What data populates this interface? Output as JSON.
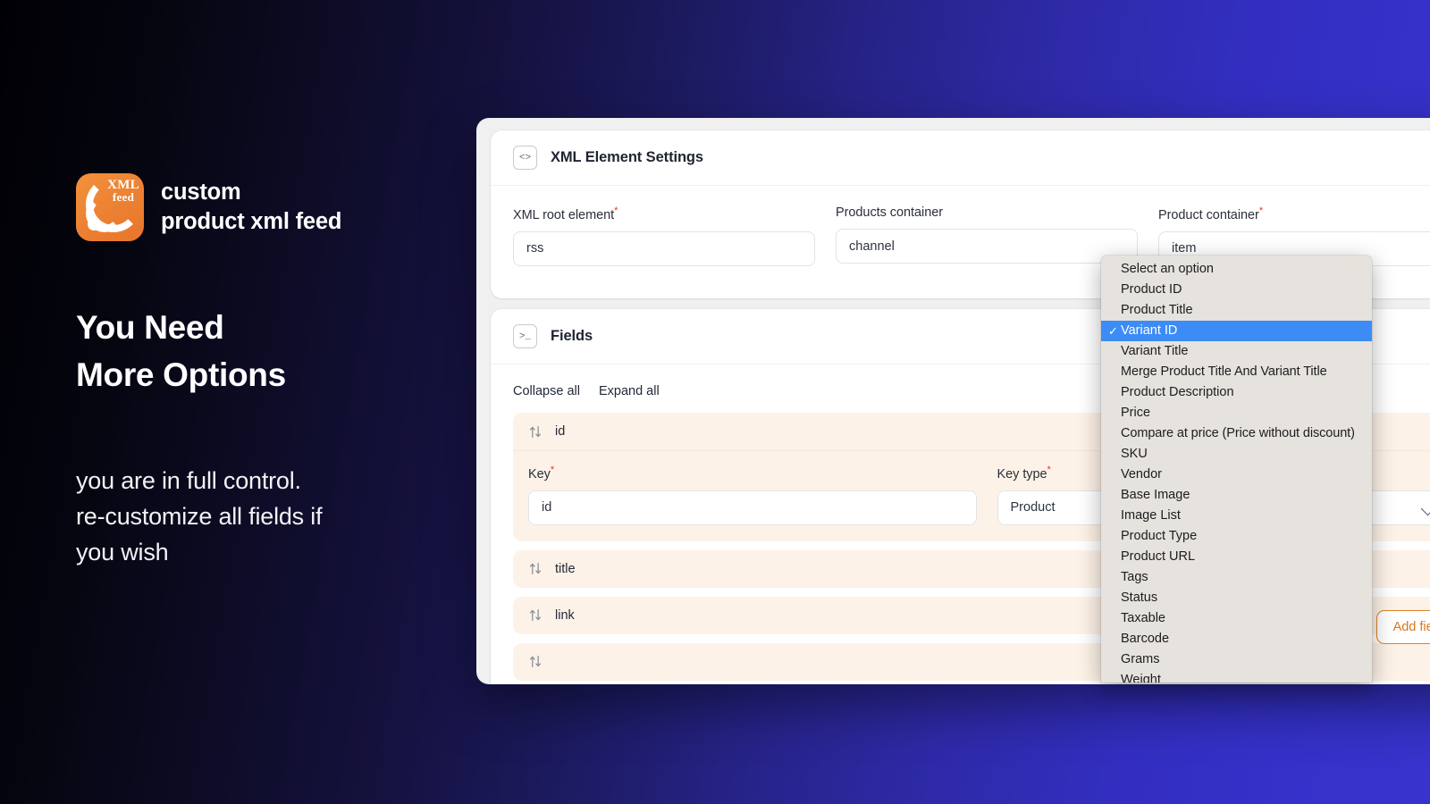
{
  "promo": {
    "logo_icon": "rss-xml-feed-icon",
    "logo_badge_top": "XML",
    "logo_badge_bottom": "feed",
    "brand_line1": "custom",
    "brand_line2": "product xml feed",
    "headline_line1": "You Need",
    "headline_line2": "More Options",
    "subcopy_line1": "you are in full control.",
    "subcopy_line2": "re-customize all fields if",
    "subcopy_line3": "you wish"
  },
  "colors": {
    "brand_orange": "#e8752b",
    "accent_blue": "#3c8cf5",
    "field_bg": "#fdf2e7",
    "required_red": "#e4352b",
    "backdrop_right": "#3733cc",
    "backdrop_left": "#000004"
  },
  "xml_card": {
    "icon": "code-brackets-icon",
    "title": "XML Element Settings",
    "collapse_icon": "chevron-up-icon",
    "fields": [
      {
        "label": "XML root element",
        "required": true,
        "value": "rss"
      },
      {
        "label": "Products container",
        "required": false,
        "value": "channel"
      },
      {
        "label": "Product container",
        "required": true,
        "value": "item"
      }
    ]
  },
  "fields_card": {
    "icon": "terminal-icon",
    "title": "Fields",
    "collapse_icon": "chevron-up-icon",
    "collapse_all_label": "Collapse all",
    "expand_all_label": "Expand all",
    "add_button_label": "Add field",
    "rows": [
      {
        "name": "id",
        "drag_icon": "reorder-arrows-icon",
        "expanded": true,
        "key_label": "Key",
        "key_required": true,
        "key_value": "id",
        "key_type_label": "Key type",
        "key_type_required": true,
        "key_type_value": "Product"
      },
      {
        "name": "title",
        "drag_icon": "reorder-arrows-icon",
        "expanded": false
      },
      {
        "name": "link",
        "drag_icon": "reorder-arrows-icon",
        "expanded": false
      },
      {
        "name": "",
        "drag_icon": "reorder-arrows-icon",
        "expanded": false
      }
    ]
  },
  "select_popup": {
    "open_for": "Product container",
    "selected": "Variant ID",
    "check_glyph": "✓",
    "options": [
      "Select an option",
      "Product ID",
      "Product Title",
      "Variant ID",
      "Variant Title",
      "Merge Product Title And Variant Title",
      "Product Description",
      "Price",
      "Compare at price (Price without discount)",
      "SKU",
      "Vendor",
      "Base Image",
      "Image List",
      "Product Type",
      "Product URL",
      "Tags",
      "Status",
      "Taxable",
      "Barcode",
      "Grams",
      "Weight"
    ]
  }
}
